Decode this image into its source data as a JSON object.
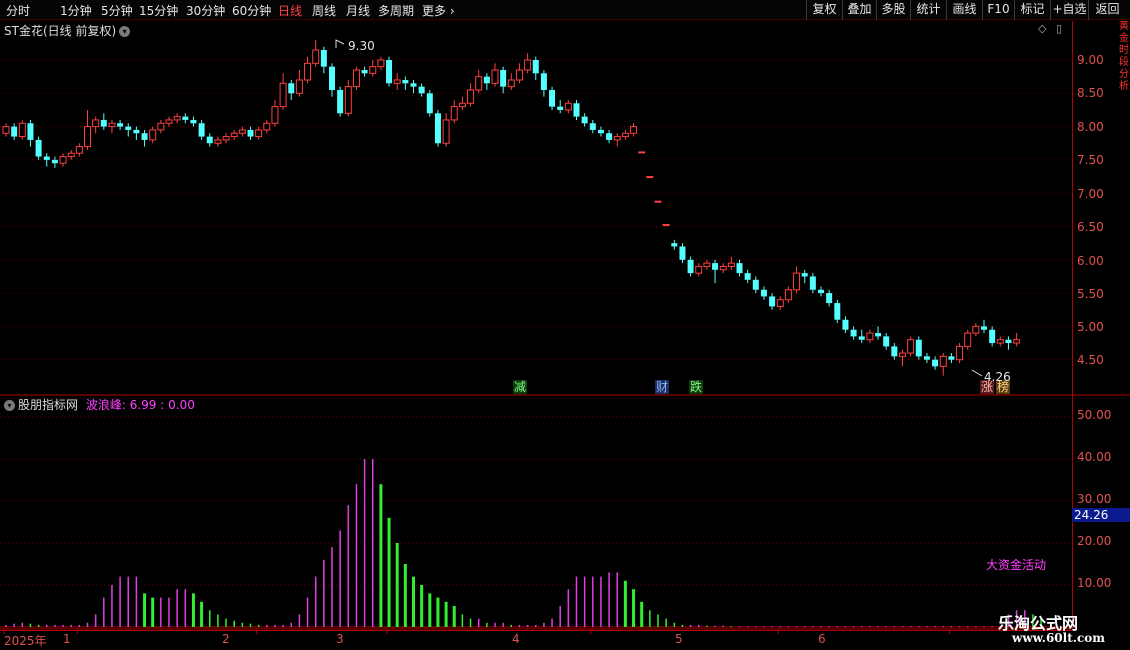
{
  "toolbar": {
    "periods": [
      "分时",
      "1分钟",
      "5分钟",
      "15分钟",
      "30分钟",
      "60分钟",
      "日线",
      "周线",
      "月线",
      "多周期",
      "更多"
    ],
    "active_period": "日线",
    "buttons": [
      "复权",
      "叠加",
      "多股",
      "统计",
      "画线",
      "F10",
      "标记",
      "+自选",
      "返回"
    ]
  },
  "price_panel": {
    "title": "ST金花(日线 前复权)",
    "high_label": "9.30",
    "low_label": "4.26",
    "annotations": [
      "减",
      "财",
      "跌",
      "涨",
      "榜"
    ]
  },
  "indicator_panel": {
    "name": "股朋指标网",
    "series_label": "波浪峰:",
    "series_value": "6.99",
    "extra_value": ": 0.00",
    "current_value": "24.26",
    "big_fund_label": "大资金活动"
  },
  "side_strip_text": "黄金时段分析",
  "watermark": {
    "line1": "乐淘公式网",
    "line2": "www.60lt.com"
  },
  "colors": {
    "up": "#ff4040",
    "down": "#54ffff",
    "volume_green": "#33ee33",
    "volume_magenta": "#e040e0",
    "grid": "#700000",
    "axis": "#b00000"
  },
  "chart_data": [
    {
      "type": "candlestick",
      "title": "ST金花(日线 前复权)",
      "ylim": [
        4.0,
        9.6
      ],
      "y_ticks": [
        "9.00",
        "8.50",
        "8.00",
        "7.50",
        "7.00",
        "6.50",
        "6.00",
        "5.50",
        "5.00",
        "4.50"
      ],
      "x_ticks": [
        "2025年",
        "1",
        "2",
        "3",
        "4",
        "5",
        "6"
      ],
      "tick_day_index": [
        0,
        9,
        31,
        47,
        72,
        95,
        116
      ],
      "grid": true,
      "bars": [
        [
          7.9,
          8.0,
          8.05,
          7.85
        ],
        [
          8.0,
          7.85,
          8.05,
          7.8
        ],
        [
          7.85,
          8.05,
          8.1,
          7.8
        ],
        [
          8.05,
          7.8,
          8.1,
          7.7
        ],
        [
          7.8,
          7.55,
          7.85,
          7.5
        ],
        [
          7.55,
          7.5,
          7.6,
          7.4
        ],
        [
          7.5,
          7.45,
          7.55,
          7.38
        ],
        [
          7.45,
          7.55,
          7.6,
          7.4
        ],
        [
          7.55,
          7.6,
          7.65,
          7.5
        ],
        [
          7.6,
          7.7,
          7.75,
          7.55
        ],
        [
          7.7,
          8.0,
          8.25,
          7.65
        ],
        [
          8.0,
          8.1,
          8.15,
          7.9
        ],
        [
          8.1,
          8.0,
          8.2,
          7.95
        ],
        [
          8.0,
          8.05,
          8.1,
          7.9
        ],
        [
          8.05,
          8.0,
          8.1,
          7.95
        ],
        [
          8.0,
          7.95,
          8.05,
          7.85
        ],
        [
          7.95,
          7.9,
          8.0,
          7.8
        ],
        [
          7.9,
          7.8,
          7.95,
          7.7
        ],
        [
          7.8,
          7.95,
          8.0,
          7.75
        ],
        [
          7.95,
          8.05,
          8.1,
          7.9
        ],
        [
          8.05,
          8.1,
          8.15,
          8.0
        ],
        [
          8.1,
          8.15,
          8.2,
          8.05
        ],
        [
          8.15,
          8.1,
          8.2,
          8.05
        ],
        [
          8.1,
          8.05,
          8.15,
          8.0
        ],
        [
          8.05,
          7.85,
          8.1,
          7.8
        ],
        [
          7.85,
          7.75,
          7.9,
          7.7
        ],
        [
          7.75,
          7.8,
          7.85,
          7.7
        ],
        [
          7.8,
          7.85,
          7.9,
          7.75
        ],
        [
          7.85,
          7.9,
          7.95,
          7.8
        ],
        [
          7.9,
          7.95,
          8.0,
          7.85
        ],
        [
          7.95,
          7.85,
          8.0,
          7.8
        ],
        [
          7.85,
          7.95,
          8.0,
          7.8
        ],
        [
          7.95,
          8.05,
          8.1,
          7.9
        ],
        [
          8.05,
          8.3,
          8.4,
          8.0
        ],
        [
          8.3,
          8.65,
          8.8,
          8.25
        ],
        [
          8.65,
          8.5,
          8.7,
          8.4
        ],
        [
          8.5,
          8.7,
          8.85,
          8.45
        ],
        [
          8.7,
          8.95,
          9.05,
          8.65
        ],
        [
          8.95,
          9.15,
          9.3,
          8.9
        ],
        [
          9.15,
          8.9,
          9.2,
          8.8
        ],
        [
          8.9,
          8.55,
          8.95,
          8.45
        ],
        [
          8.55,
          8.2,
          8.6,
          8.15
        ],
        [
          8.2,
          8.6,
          8.7,
          8.15
        ],
        [
          8.6,
          8.85,
          8.9,
          8.55
        ],
        [
          8.85,
          8.8,
          8.9,
          8.75
        ],
        [
          8.8,
          8.9,
          9.0,
          8.75
        ],
        [
          8.9,
          9.0,
          9.05,
          8.85
        ],
        [
          9.0,
          8.65,
          9.05,
          8.6
        ],
        [
          8.65,
          8.7,
          8.8,
          8.55
        ],
        [
          8.7,
          8.65,
          8.75,
          8.55
        ],
        [
          8.65,
          8.6,
          8.7,
          8.5
        ],
        [
          8.6,
          8.5,
          8.65,
          8.45
        ],
        [
          8.5,
          8.2,
          8.55,
          8.15
        ],
        [
          8.2,
          7.75,
          8.25,
          7.7
        ],
        [
          7.75,
          8.1,
          8.2,
          7.7
        ],
        [
          8.1,
          8.3,
          8.4,
          8.05
        ],
        [
          8.3,
          8.35,
          8.45,
          8.25
        ],
        [
          8.35,
          8.55,
          8.65,
          8.3
        ],
        [
          8.55,
          8.75,
          8.85,
          8.5
        ],
        [
          8.75,
          8.65,
          8.8,
          8.55
        ],
        [
          8.65,
          8.85,
          8.95,
          8.6
        ],
        [
          8.85,
          8.6,
          8.9,
          8.5
        ],
        [
          8.6,
          8.7,
          8.8,
          8.55
        ],
        [
          8.7,
          8.85,
          8.95,
          8.65
        ],
        [
          8.85,
          9.0,
          9.1,
          8.8
        ],
        [
          9.0,
          8.8,
          9.05,
          8.7
        ],
        [
          8.8,
          8.55,
          8.85,
          8.45
        ],
        [
          8.55,
          8.3,
          8.6,
          8.25
        ],
        [
          8.3,
          8.25,
          8.4,
          8.2
        ],
        [
          8.25,
          8.35,
          8.4,
          8.2
        ],
        [
          8.35,
          8.15,
          8.4,
          8.1
        ],
        [
          8.15,
          8.05,
          8.2,
          8.0
        ],
        [
          8.05,
          7.95,
          8.1,
          7.9
        ],
        [
          7.95,
          7.9,
          8.0,
          7.85
        ],
        [
          7.9,
          7.8,
          7.95,
          7.75
        ],
        [
          7.8,
          7.85,
          7.9,
          7.7
        ],
        [
          7.85,
          7.9,
          7.95,
          7.8
        ],
        [
          7.9,
          8.0,
          8.05,
          7.85
        ],
        [
          7.62,
          7.62,
          7.62,
          7.62
        ],
        [
          7.25,
          7.25,
          7.25,
          7.25
        ],
        [
          6.88,
          6.88,
          6.88,
          6.88
        ],
        [
          6.53,
          6.53,
          6.53,
          6.53
        ],
        [
          6.25,
          6.2,
          6.3,
          6.15
        ],
        [
          6.2,
          6.0,
          6.25,
          5.95
        ],
        [
          6.0,
          5.8,
          6.05,
          5.75
        ],
        [
          5.8,
          5.9,
          5.95,
          5.75
        ],
        [
          5.9,
          5.95,
          6.0,
          5.85
        ],
        [
          5.95,
          5.85,
          6.0,
          5.65
        ],
        [
          5.85,
          5.9,
          5.95,
          5.8
        ],
        [
          5.9,
          5.95,
          6.05,
          5.85
        ],
        [
          5.95,
          5.8,
          6.0,
          5.75
        ],
        [
          5.8,
          5.7,
          5.85,
          5.65
        ],
        [
          5.7,
          5.55,
          5.75,
          5.5
        ],
        [
          5.55,
          5.45,
          5.6,
          5.4
        ],
        [
          5.45,
          5.3,
          5.5,
          5.25
        ],
        [
          5.3,
          5.4,
          5.45,
          5.25
        ],
        [
          5.4,
          5.55,
          5.6,
          5.35
        ],
        [
          5.55,
          5.8,
          5.9,
          5.5
        ],
        [
          5.8,
          5.75,
          5.85,
          5.65
        ],
        [
          5.75,
          5.55,
          5.8,
          5.5
        ],
        [
          5.55,
          5.5,
          5.6,
          5.45
        ],
        [
          5.5,
          5.35,
          5.55,
          5.3
        ],
        [
          5.35,
          5.1,
          5.4,
          5.05
        ],
        [
          5.1,
          4.95,
          5.15,
          4.9
        ],
        [
          4.95,
          4.85,
          5.0,
          4.8
        ],
        [
          4.85,
          4.8,
          4.95,
          4.75
        ],
        [
          4.8,
          4.9,
          4.95,
          4.75
        ],
        [
          4.9,
          4.85,
          5.0,
          4.8
        ],
        [
          4.85,
          4.7,
          4.9,
          4.65
        ],
        [
          4.7,
          4.55,
          4.75,
          4.5
        ],
        [
          4.55,
          4.6,
          4.65,
          4.4
        ],
        [
          4.6,
          4.8,
          4.85,
          4.55
        ],
        [
          4.8,
          4.55,
          4.85,
          4.5
        ],
        [
          4.55,
          4.5,
          4.6,
          4.45
        ],
        [
          4.5,
          4.4,
          4.55,
          4.35
        ],
        [
          4.4,
          4.55,
          4.6,
          4.26
        ],
        [
          4.55,
          4.5,
          4.6,
          4.45
        ],
        [
          4.5,
          4.7,
          4.75,
          4.45
        ],
        [
          4.7,
          4.9,
          4.95,
          4.65
        ],
        [
          4.9,
          5.0,
          5.05,
          4.85
        ],
        [
          5.0,
          4.95,
          5.1,
          4.9
        ],
        [
          4.95,
          4.75,
          5.0,
          4.7
        ],
        [
          4.75,
          4.8,
          4.85,
          4.7
        ],
        [
          4.8,
          4.75,
          4.85,
          4.65
        ],
        [
          4.75,
          4.8,
          4.9,
          4.7
        ]
      ]
    },
    {
      "type": "bar",
      "title": "股朋指标网",
      "ylim": [
        0,
        55
      ],
      "y_ticks": [
        "50.00",
        "40.00",
        "30.00",
        "20.00",
        "10.00"
      ],
      "series": [
        {
          "name": "波浪峰",
          "values": [
            0.5,
            0.8,
            1,
            0.8,
            0.5,
            0.5,
            0.5,
            0.5,
            0.5,
            0.5,
            1,
            3,
            7,
            10,
            12,
            12,
            12,
            8,
            7,
            7,
            7,
            9,
            9,
            8,
            6,
            4,
            3,
            2,
            1.5,
            1,
            0.8,
            0.5,
            0.5,
            0.5,
            0.5,
            1,
            3,
            7,
            12,
            16,
            19,
            23,
            29,
            34,
            40,
            40,
            34,
            26,
            20,
            15,
            12,
            10,
            8,
            7,
            6,
            5,
            3,
            2,
            2,
            1,
            1,
            1,
            0.5,
            0.5,
            0.5,
            0.5,
            1,
            2,
            5,
            9,
            12,
            12,
            12,
            12,
            13,
            13,
            11,
            9,
            6,
            4,
            3,
            2,
            1,
            0.5,
            0.5,
            0.5,
            0.3,
            0.3,
            0.3,
            0.2,
            0.2,
            0.2,
            0.2,
            0.2,
            0.2,
            0.2,
            0.2,
            0.2,
            0.2,
            0.2,
            0.2,
            0.2,
            0.2,
            0.2,
            0.2,
            0.2,
            0.2,
            0.2,
            0.2,
            0.2,
            0.2,
            0.2,
            0.2,
            0.2,
            0.2,
            0.2,
            0.2,
            0.2,
            0.2,
            0.2,
            0.2,
            0.2,
            0.2,
            3,
            4,
            4,
            3,
            2
          ]
        },
        {
          "name": "",
          "colors_by_index": "magenta=rising, green=falling"
        }
      ]
    }
  ]
}
